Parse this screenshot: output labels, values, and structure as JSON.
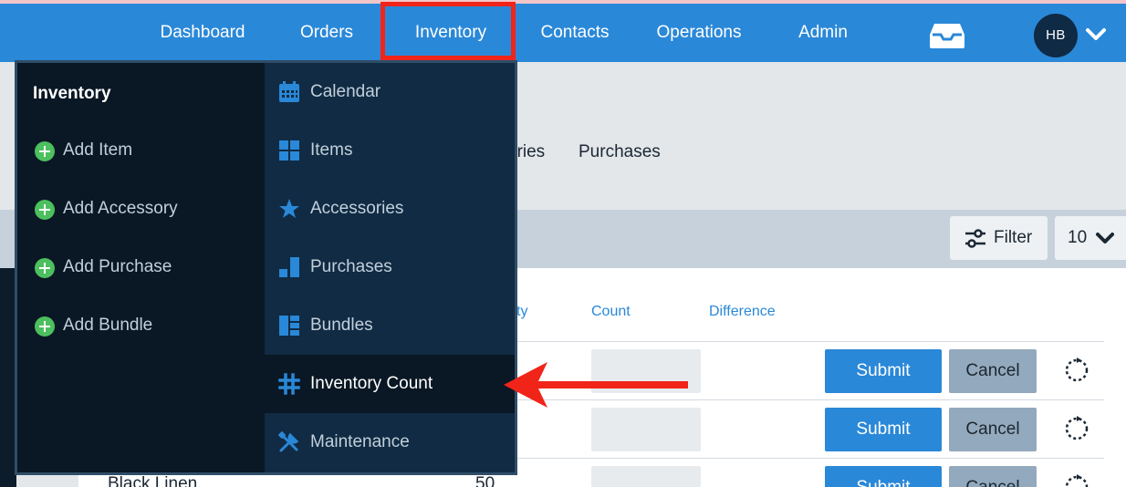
{
  "nav": {
    "items": [
      "Dashboard",
      "Orders",
      "Inventory",
      "Contacts",
      "Operations",
      "Admin"
    ],
    "user_initials": "HB"
  },
  "colors": {
    "nav_blue": "#2a88d8",
    "menu_dark": "#0a1724",
    "menu_panel": "#102b43",
    "plus_green": "#4cbf5e",
    "highlight_red": "#f1241a"
  },
  "menu": {
    "title": "Inventory",
    "quick_actions": [
      "Add Item",
      "Add Accessory",
      "Add Purchase",
      "Add Bundle"
    ],
    "links": [
      {
        "label": "Calendar",
        "icon": "calendar-icon"
      },
      {
        "label": "Items",
        "icon": "grid-icon"
      },
      {
        "label": "Accessories",
        "icon": "star-icon"
      },
      {
        "label": "Purchases",
        "icon": "bar-chart-icon"
      },
      {
        "label": "Bundles",
        "icon": "layout-icon"
      },
      {
        "label": "Inventory Count",
        "icon": "hash-icon"
      },
      {
        "label": "Maintenance",
        "icon": "tools-icon"
      }
    ],
    "active_link": "Inventory Count"
  },
  "page": {
    "tab_partial": "ories",
    "tab_purchases": "Purchases",
    "filter_label": "Filter",
    "per_page": "10",
    "columns": {
      "qty_partial": "ty",
      "count": "Count",
      "difference": "Difference"
    },
    "submit_label": "Submit",
    "cancel_label": "Cancel",
    "last_row": {
      "name": "Black Linen",
      "qty": "50"
    }
  }
}
